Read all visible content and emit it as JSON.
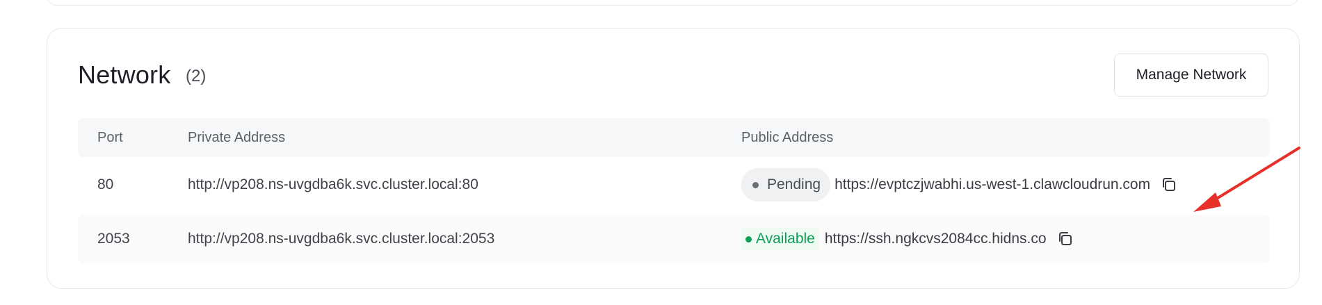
{
  "network": {
    "title": "Network",
    "count": "(2)",
    "manage_label": "Manage Network",
    "columns": {
      "port": "Port",
      "private": "Private Address",
      "public": "Public Address"
    },
    "rows": [
      {
        "port": "80",
        "private": "http://vp208.ns-uvgdba6k.svc.cluster.local:80",
        "status": "Pending",
        "public": "https://evptczjwabhi.us-west-1.clawcloudrun.com"
      },
      {
        "port": "2053",
        "private": "http://vp208.ns-uvgdba6k.svc.cluster.local:2053",
        "status": "Available",
        "public": "https://ssh.ngkcvs2084cc.hidns.co"
      }
    ]
  },
  "colors": {
    "pending_dot": "#6b6e75",
    "available": "#0d9f55",
    "annotation_arrow": "#e8302a"
  },
  "icons": {
    "copy": "copy-icon",
    "status": "status-dot-icon",
    "annotation": "annotation-arrow-icon"
  }
}
